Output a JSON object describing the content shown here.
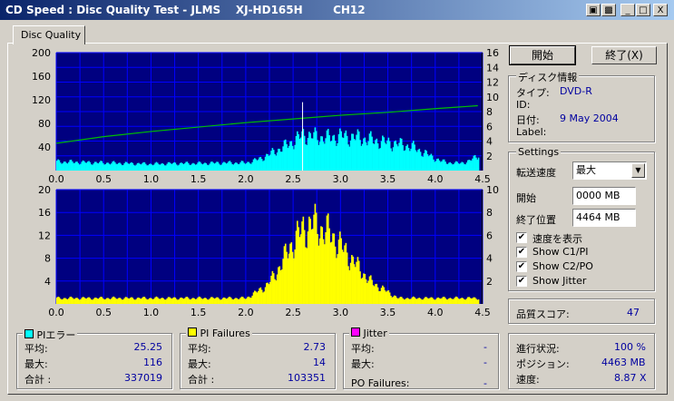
{
  "window": {
    "title": "CD Speed : Disc Quality Test - JLMS    XJ-HD165H        CH12",
    "minimize": "_",
    "maximize": "□",
    "close": "X"
  },
  "tab": {
    "label": "Disc Quality"
  },
  "buttons": {
    "start": "開始",
    "exit": "終了(X)"
  },
  "disc_info": {
    "group_label": "ディスク情報",
    "type_label": "タイプ:",
    "type_value": "DVD-R",
    "id_label": "ID:",
    "id_value": "",
    "date_label": "日付:",
    "date_value": "9 May 2004",
    "disc_label_label": "Label:",
    "disc_label_value": ""
  },
  "settings": {
    "group_label": "Settings",
    "speed_label": "転送速度",
    "speed_value": "最大",
    "start_label": "開始",
    "start_value": "0000 MB",
    "end_label": "終了位置",
    "end_value": "4464 MB",
    "show_speed": "速度を表示",
    "show_c1pi": "Show C1/PI",
    "show_c2po": "Show C2/PO",
    "show_jitter": "Show Jitter"
  },
  "quality": {
    "label": "品質スコア:",
    "value": "47"
  },
  "progress": {
    "progress_label": "進行状況:",
    "progress_value": "100 %",
    "position_label": "ポジション:",
    "position_value": "4463 MB",
    "speed_label": "速度:",
    "speed_value": "8.87 X"
  },
  "pi_errors": {
    "label": "PIエラー",
    "color": "#00ffff",
    "avg_label": "平均:",
    "avg_value": "25.25",
    "max_label": "最大:",
    "max_value": "116",
    "total_label": "合計 :",
    "total_value": "337019"
  },
  "pi_failures": {
    "label": "PI Failures",
    "color": "#ffff00",
    "avg_label": "平均:",
    "avg_value": "2.73",
    "max_label": "最大:",
    "max_value": "14",
    "total_label": "合計 :",
    "total_value": "103351"
  },
  "jitter": {
    "label": "Jitter",
    "color": "#ff00ff",
    "avg_label": "平均:",
    "avg_value": "-",
    "max_label": "最大:",
    "max_value": "-",
    "po_label": "PO Failures:",
    "po_value": "-"
  },
  "colors": {
    "plot_bg": "#000080",
    "grid": "#0000ff",
    "pi_fill": "#00ffff",
    "pif_fill": "#ffff00",
    "speed_line": "#00c000",
    "marker": "#ffffff"
  },
  "chart_data": [
    {
      "type": "area",
      "title": "",
      "xlabel": "",
      "ylabel": "",
      "x_ticks": [
        "0.0",
        "0.5",
        "1.0",
        "1.5",
        "2.0",
        "2.5",
        "3.0",
        "3.5",
        "4.0",
        "4.5"
      ],
      "xlim": [
        0,
        4.5
      ],
      "y_ticks_left": [
        "200",
        "160",
        "120",
        "80",
        "40"
      ],
      "ylim_left": [
        0,
        200
      ],
      "y_ticks_right": [
        "16",
        "14",
        "12",
        "10",
        "8",
        "6",
        "4",
        "2"
      ],
      "ylim_right": [
        0,
        16
      ],
      "grid": true,
      "series": [
        {
          "name": "PIエラー",
          "axis": "left",
          "x": [
            0.0,
            0.25,
            0.5,
            0.75,
            1.0,
            1.25,
            1.5,
            1.75,
            2.0,
            2.15,
            2.3,
            2.45,
            2.55,
            2.6,
            2.7,
            2.85,
            3.0,
            3.15,
            3.3,
            3.45,
            3.6,
            3.75,
            3.9,
            4.05,
            4.2,
            4.35,
            4.45
          ],
          "values": [
            15,
            14,
            13,
            12,
            11,
            12,
            12,
            13,
            13,
            20,
            32,
            45,
            55,
            60,
            58,
            55,
            58,
            56,
            52,
            48,
            45,
            40,
            28,
            16,
            12,
            15,
            28
          ]
        },
        {
          "name": "速度",
          "axis": "right",
          "x": [
            0.0,
            0.5,
            1.0,
            1.5,
            2.0,
            2.5,
            3.0,
            3.5,
            4.0,
            4.45
          ],
          "values": [
            3.7,
            4.6,
            5.3,
            5.9,
            6.5,
            7.0,
            7.5,
            7.9,
            8.4,
            8.8
          ]
        }
      ],
      "markers": [
        {
          "x": 2.6,
          "value": 116
        }
      ]
    },
    {
      "type": "bar",
      "title": "",
      "xlabel": "",
      "ylabel": "",
      "x_ticks": [
        "0.0",
        "0.5",
        "1.0",
        "1.5",
        "2.0",
        "2.5",
        "3.0",
        "3.5",
        "4.0",
        "4.5"
      ],
      "xlim": [
        0,
        4.5
      ],
      "y_ticks_left": [
        "20",
        "16",
        "12",
        "8",
        "4"
      ],
      "ylim_left": [
        0,
        20
      ],
      "y_ticks_right": [
        "10",
        "8",
        "6",
        "4",
        "2"
      ],
      "ylim_right": [
        0,
        10
      ],
      "grid": true,
      "series": [
        {
          "name": "PI Failures",
          "axis": "left",
          "x": [
            0.0,
            0.25,
            0.5,
            0.75,
            1.0,
            1.25,
            1.5,
            1.75,
            2.0,
            2.1,
            2.2,
            2.3,
            2.4,
            2.5,
            2.6,
            2.7,
            2.8,
            2.9,
            3.0,
            3.1,
            3.2,
            3.3,
            3.4,
            3.5,
            3.6,
            3.75,
            4.0,
            4.25,
            4.45
          ],
          "values": [
            1,
            1,
            1,
            1,
            1,
            1,
            1,
            1,
            1,
            2,
            3,
            5,
            8,
            11,
            13,
            14,
            13,
            12,
            10,
            8,
            6,
            4,
            3,
            2,
            1,
            1,
            1,
            1,
            1
          ]
        }
      ]
    }
  ]
}
